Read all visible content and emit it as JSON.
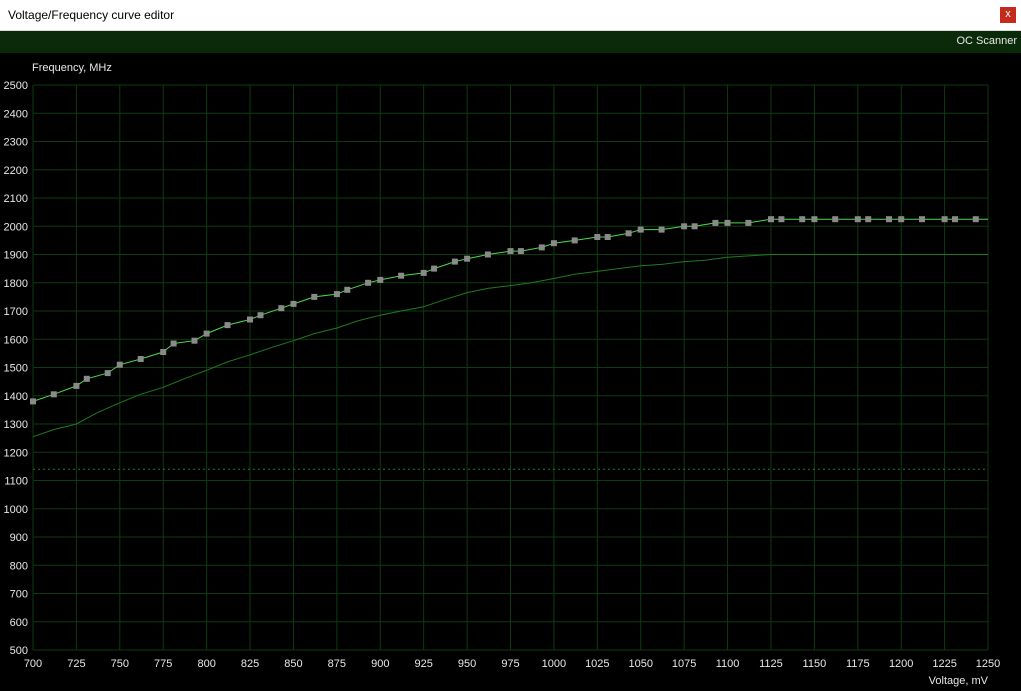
{
  "window": {
    "title": "Voltage/Frequency curve editor",
    "close_label": "x"
  },
  "toolbar": {
    "oc_scanner_label": "OC Scanner"
  },
  "colors": {
    "background": "#000000",
    "grid": "#0f3a0f",
    "curve": "#4cdc4c",
    "baseline_curve": "#1f7a1f",
    "point": "#8a8a8a",
    "reference_line": "#1f7a1f",
    "text": "#e8e8e8"
  },
  "chart_data": {
    "type": "line",
    "ylabel": "Frequency, MHz",
    "xlabel": "Voltage, mV",
    "xlim": [
      700,
      1250
    ],
    "ylim": [
      500,
      2500
    ],
    "x_ticks": [
      700,
      725,
      750,
      775,
      800,
      825,
      850,
      875,
      900,
      925,
      950,
      975,
      1000,
      1025,
      1050,
      1075,
      1100,
      1125,
      1150,
      1175,
      1200,
      1225,
      1250
    ],
    "y_ticks": [
      500,
      600,
      700,
      800,
      900,
      1000,
      1100,
      1200,
      1300,
      1400,
      1500,
      1600,
      1700,
      1800,
      1900,
      2000,
      2100,
      2200,
      2300,
      2400,
      2500
    ],
    "grid": true,
    "reference_line": {
      "y": 1140,
      "style": "dotted"
    },
    "series": [
      {
        "role": "edited-curve",
        "x": [
          700,
          712,
          725,
          731,
          743,
          750,
          762,
          775,
          781,
          793,
          800,
          812,
          825,
          831,
          843,
          850,
          862,
          875,
          881,
          893,
          900,
          912,
          925,
          931,
          943,
          950,
          962,
          975,
          981,
          993,
          1000,
          1012,
          1025,
          1031,
          1043,
          1050,
          1062,
          1075,
          1081,
          1093,
          1100,
          1112,
          1125,
          1131,
          1143,
          1150,
          1162,
          1175,
          1181,
          1193,
          1200,
          1212,
          1225,
          1231,
          1243
        ],
        "y": [
          1380,
          1405,
          1435,
          1460,
          1480,
          1510,
          1530,
          1555,
          1585,
          1595,
          1620,
          1650,
          1670,
          1685,
          1710,
          1725,
          1750,
          1760,
          1775,
          1800,
          1810,
          1825,
          1835,
          1850,
          1875,
          1885,
          1900,
          1912,
          1912,
          1925,
          1940,
          1950,
          1962,
          1962,
          1975,
          1988,
          1988,
          2000,
          2000,
          2012,
          2012,
          2012,
          2025,
          2025,
          2025,
          2025,
          2025,
          2025,
          2025,
          2025,
          2025,
          2025,
          2025,
          2025,
          2025
        ]
      },
      {
        "role": "default-curve",
        "x": [
          700,
          712,
          725,
          737,
          750,
          762,
          775,
          787,
          800,
          812,
          825,
          837,
          850,
          862,
          875,
          887,
          900,
          912,
          925,
          937,
          950,
          962,
          975,
          987,
          1000,
          1012,
          1025,
          1037,
          1050,
          1062,
          1075,
          1087,
          1100,
          1112,
          1125,
          1137,
          1150,
          1175,
          1200,
          1225,
          1250
        ],
        "y": [
          1255,
          1280,
          1300,
          1340,
          1375,
          1405,
          1430,
          1460,
          1490,
          1520,
          1545,
          1570,
          1595,
          1620,
          1640,
          1665,
          1685,
          1700,
          1715,
          1740,
          1765,
          1780,
          1790,
          1800,
          1815,
          1830,
          1840,
          1850,
          1860,
          1865,
          1875,
          1880,
          1890,
          1895,
          1900,
          1900,
          1900,
          1900,
          1900,
          1900,
          1900
        ]
      }
    ]
  }
}
